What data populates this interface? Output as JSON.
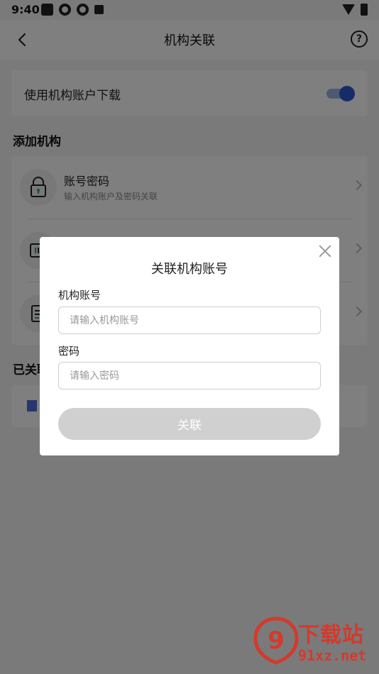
{
  "status_bar": {
    "time": "9:40",
    "icons": [
      "square-notification-icon",
      "app-notification-icon",
      "app-notification-icon",
      "a-notification-icon",
      "wifi-icon",
      "battery-icon"
    ]
  },
  "app_bar": {
    "title": "机构关联",
    "back_icon": "back-arrow-icon",
    "help_icon": "help-circle-icon",
    "help_glyph": "?"
  },
  "settings": {
    "toggle_label": "使用机构账户下载",
    "toggle_on": true,
    "accent_color": "#2f57d1"
  },
  "add_section": {
    "title": "添加机构",
    "methods": [
      {
        "title": "账号密码",
        "subtitle": "输入机构账户及密码关联",
        "icon": "lock-icon"
      },
      {
        "title": "",
        "subtitle": "",
        "icon": "scan-icon"
      },
      {
        "title": "",
        "subtitle": "",
        "icon": "document-icon"
      }
    ]
  },
  "linked_section": {
    "title": "已关联",
    "icon": "building-icon"
  },
  "dialog": {
    "title": "关联机构账号",
    "account_label": "机构账号",
    "account_placeholder": "请输入机构账号",
    "account_value": "",
    "password_label": "密码",
    "password_placeholder": "请输入密码",
    "password_value": "",
    "submit_label": "关联",
    "close_icon": "close-icon"
  },
  "watermark": {
    "logo_text": "9",
    "top_text": "下载站",
    "bottom_text": "91xz.net"
  }
}
